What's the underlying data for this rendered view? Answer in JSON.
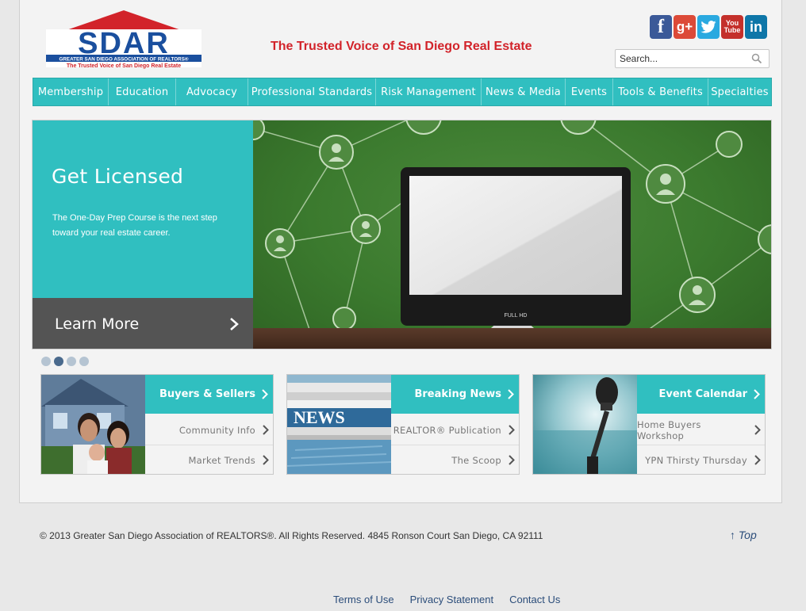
{
  "header": {
    "logo_text": "SDAR",
    "logo_subtitle": "GREATER SAN DIEGO ASSOCIATION OF REALTORS®",
    "logo_tagline": "The Trusted Voice of San Diego Real Estate",
    "tagline": "The Trusted Voice of San Diego Real Estate",
    "search_placeholder": "Search...",
    "social": [
      {
        "name": "facebook",
        "glyph": "f"
      },
      {
        "name": "google-plus",
        "glyph": "g+"
      },
      {
        "name": "twitter",
        "glyph": "🐦"
      },
      {
        "name": "youtube",
        "glyph": "You Tube"
      },
      {
        "name": "linkedin",
        "glyph": "in"
      }
    ]
  },
  "nav": {
    "items": [
      "Membership",
      "Education",
      "Advocacy",
      "Professional Standards",
      "Risk Management",
      "News & Media",
      "Events",
      "Tools & Benefits",
      "Specialties"
    ]
  },
  "hero": {
    "title": "Get Licensed",
    "text": "The One-Day Prep Course is the next step toward your real estate career.",
    "cta": "Learn More",
    "monitor_label": "FULL HD",
    "slides": 4,
    "active_slide": 2
  },
  "promos": [
    {
      "title": "Buyers & Sellers",
      "links": [
        "Community Info",
        "Market Trends"
      ],
      "image": "family-photo"
    },
    {
      "title": "Breaking News",
      "links": [
        "REALTOR® Publication",
        "The Scoop"
      ],
      "image": "newspaper-photo"
    },
    {
      "title": "Event Calendar",
      "links": [
        "Home Buyers Workshop",
        "YPN Thirsty Thursday"
      ],
      "image": "microphone-photo"
    }
  ],
  "footer": {
    "copyright": "© 2013 Greater San Diego Association of REALTORS®. All Rights Reserved. 4845 Ronson Court San Diego, CA 92111",
    "top": "↑ Top",
    "links": [
      "Terms of Use",
      "Privacy Statement",
      "Contact Us"
    ]
  },
  "colors": {
    "accent": "#30bfc0",
    "tagline_red": "#d2232a",
    "logo_blue": "#1a4f9e",
    "footer_link": "#2b4d7a"
  }
}
